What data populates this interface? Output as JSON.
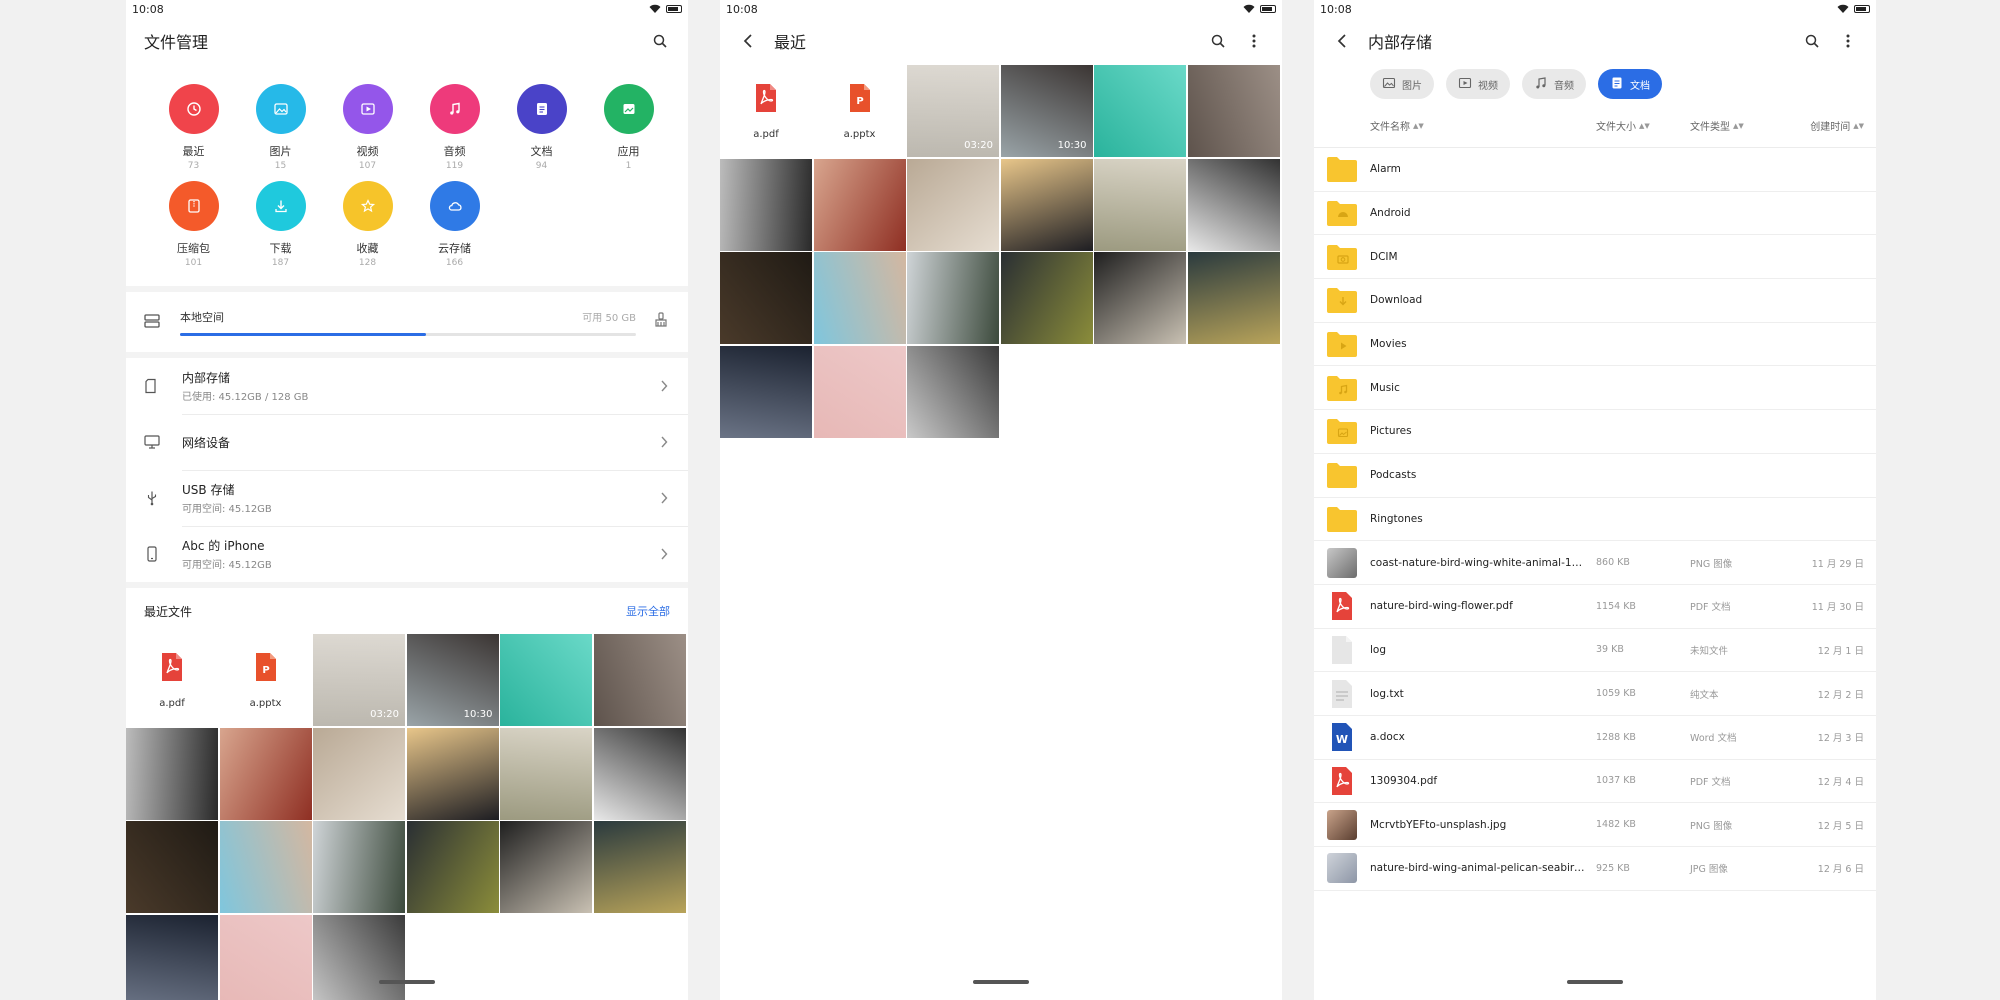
{
  "status": {
    "time": "10:08"
  },
  "home": {
    "title": "文件管理",
    "categories": [
      {
        "label": "最近",
        "count": "73",
        "color": "#f0444b",
        "icon": "clock-icon"
      },
      {
        "label": "图片",
        "count": "15",
        "color": "#26b9e8",
        "icon": "image-icon"
      },
      {
        "label": "视频",
        "count": "107",
        "color": "#9456ea",
        "icon": "video-icon"
      },
      {
        "label": "音频",
        "count": "119",
        "color": "#ee3a7b",
        "icon": "music-icon"
      },
      {
        "label": "文档",
        "count": "94",
        "color": "#4a43c8",
        "icon": "document-icon"
      },
      {
        "label": "应用",
        "count": "1",
        "color": "#23b364",
        "icon": "app-icon"
      },
      {
        "label": "压缩包",
        "count": "101",
        "color": "#f45a2a",
        "icon": "archive-icon"
      },
      {
        "label": "下载",
        "count": "187",
        "color": "#1fc9dd",
        "icon": "download-icon"
      },
      {
        "label": "收藏",
        "count": "128",
        "color": "#f6c42a",
        "icon": "star-icon"
      },
      {
        "label": "云存储",
        "count": "166",
        "color": "#2f7ae6",
        "icon": "cloud-icon"
      }
    ],
    "storage": {
      "label": "本地空间",
      "available": "可用 50 GB",
      "used_fraction": 0.54
    },
    "locations": [
      {
        "title": "内部存储",
        "subtitle": "已使用: 45.12GB / 128 GB",
        "icon": "sd-card-icon"
      },
      {
        "title": "网络设备",
        "subtitle": "",
        "icon": "monitor-icon"
      },
      {
        "title": "USB 存储",
        "subtitle": "可用空间: 45.12GB",
        "icon": "usb-icon"
      },
      {
        "title": "Abc 的 iPhone",
        "subtitle": "可用空间: 45.12GB",
        "icon": "phone-icon"
      }
    ],
    "recent": {
      "title": "最近文件",
      "show_all": "显示全部"
    }
  },
  "recent_page": {
    "title": "最近"
  },
  "tiles": [
    {
      "kind": "pdf",
      "name": "a.pdf"
    },
    {
      "kind": "pptx",
      "name": "a.pptx"
    },
    {
      "kind": "photo",
      "colors": [
        "#ddd9d2",
        "#bcb8af"
      ],
      "duration": "03:20"
    },
    {
      "kind": "photo",
      "colors": [
        "#3b3533",
        "#9aa4a8"
      ],
      "duration": "10:30"
    },
    {
      "kind": "photo",
      "colors": [
        "#6ad9c8",
        "#2ab39c"
      ]
    },
    {
      "kind": "photo",
      "colors": [
        "#9c8f86",
        "#5e534c"
      ]
    },
    {
      "kind": "photo",
      "colors": [
        "#2a2a2a",
        "#bcbcbc"
      ]
    },
    {
      "kind": "photo",
      "colors": [
        "#8f2f23",
        "#d8a58e"
      ]
    },
    {
      "kind": "photo",
      "colors": [
        "#e6ddd1",
        "#b9a995"
      ]
    },
    {
      "kind": "photo",
      "colors": [
        "#1d1d22",
        "#e8c68a"
      ]
    },
    {
      "kind": "photo",
      "colors": [
        "#9c9a80",
        "#d9d4c6"
      ]
    },
    {
      "kind": "photo",
      "colors": [
        "#e8e8e8",
        "#323232"
      ]
    },
    {
      "kind": "photo",
      "colors": [
        "#4a3a2a",
        "#1f1a14"
      ]
    },
    {
      "kind": "photo",
      "colors": [
        "#7fc6dd",
        "#d4b7a0"
      ]
    },
    {
      "kind": "photo",
      "colors": [
        "#cfd4d7",
        "#3c4a3c"
      ]
    },
    {
      "kind": "photo",
      "colors": [
        "#2a2f33",
        "#8b8d3a"
      ]
    },
    {
      "kind": "photo",
      "colors": [
        "#1f1f1f",
        "#c9c1b3"
      ]
    },
    {
      "kind": "photo",
      "colors": [
        "#2a3a3e",
        "#b9a45a"
      ]
    },
    {
      "kind": "photo",
      "colors": [
        "#1b2230",
        "#6b7486"
      ]
    },
    {
      "kind": "photo",
      "colors": [
        "#edc8c8",
        "#e7b8b6"
      ]
    },
    {
      "kind": "photo",
      "colors": [
        "#3b3b3b",
        "#c9c9c9"
      ]
    }
  ],
  "internal": {
    "title": "内部存储",
    "chips": [
      {
        "label": "图片",
        "icon": "image-icon",
        "active": false
      },
      {
        "label": "视频",
        "icon": "video-icon",
        "active": false
      },
      {
        "label": "音频",
        "icon": "music-icon",
        "active": false
      },
      {
        "label": "文档",
        "icon": "document-icon",
        "active": true
      }
    ],
    "columns": {
      "name": "文件名称",
      "size": "文件大小",
      "type": "文件类型",
      "date": "创建时间"
    },
    "folders": [
      {
        "name": "Alarm",
        "icon": "folder-icon"
      },
      {
        "name": "Android",
        "icon": "folder-android-icon"
      },
      {
        "name": "DCIM",
        "icon": "folder-camera-icon"
      },
      {
        "name": "Download",
        "icon": "folder-download-icon"
      },
      {
        "name": "Movies",
        "icon": "folder-video-icon"
      },
      {
        "name": "Music",
        "icon": "folder-music-icon"
      },
      {
        "name": "Pictures",
        "icon": "folder-image-icon"
      },
      {
        "name": "Podcasts",
        "icon": "folder-icon"
      },
      {
        "name": "Ringtones",
        "icon": "folder-icon"
      }
    ],
    "files": [
      {
        "name": "coast-nature-bird-wing-white-animal-116…",
        "size": "860 KB",
        "type": "PNG 图像",
        "date": "11 月 29 日",
        "icon": "image-thumb-icon",
        "thumb": [
          "#c8c8c8",
          "#6c6c6c"
        ]
      },
      {
        "name": "nature-bird-wing-flower.pdf",
        "size": "1154 KB",
        "type": "PDF 文档",
        "date": "11 月 30 日",
        "icon": "pdf-file-icon"
      },
      {
        "name": "log",
        "size": "39 KB",
        "type": "未知文件",
        "date": "12 月 1 日",
        "icon": "blank-file-icon"
      },
      {
        "name": "log.txt",
        "size": "1059 KB",
        "type": "纯文本",
        "date": "12 月 2 日",
        "icon": "text-file-icon"
      },
      {
        "name": "a.docx",
        "size": "1288 KB",
        "type": "Word 文档",
        "date": "12 月 3 日",
        "icon": "word-file-icon"
      },
      {
        "name": "1309304.pdf",
        "size": "1037 KB",
        "type": "PDF 文档",
        "date": "12 月 4 日",
        "icon": "pdf-file-icon"
      },
      {
        "name": "McrvtbYEFto-unsplash.jpg",
        "size": "1482 KB",
        "type": "PNG 图像",
        "date": "12 月 5 日",
        "icon": "image-thumb-icon",
        "thumb": [
          "#c9a38a",
          "#5a3e30"
        ]
      },
      {
        "name": "nature-bird-wing-animal-pelican-seabird-…",
        "size": "925 KB",
        "type": "JPG 图像",
        "date": "12 月 6 日",
        "icon": "image-thumb-icon",
        "thumb": [
          "#cfd3da",
          "#8d96a6"
        ]
      }
    ]
  }
}
